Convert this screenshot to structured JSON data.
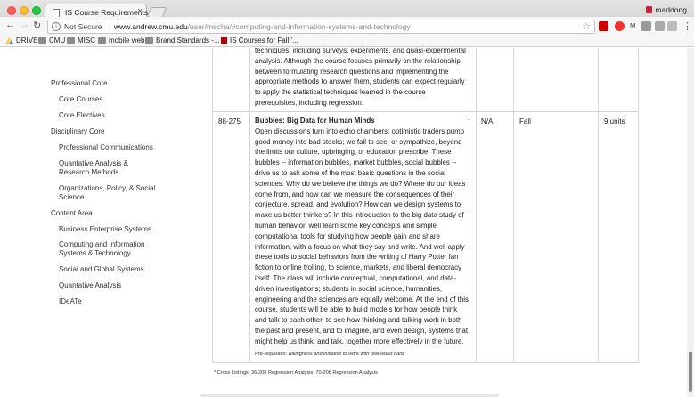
{
  "browser": {
    "tab_title": "IS Course Requirements",
    "tab_close": "×",
    "profile_name": "maddong",
    "not_secure": "Not Secure",
    "url_host": "www.andrew.cmu.edu",
    "url_path": "/user/mecha/#computing-and-information-systems-and-technology",
    "ext_m": "M",
    "bookmarks": [
      {
        "label": "DRIVE",
        "icon": "drive-icon"
      },
      {
        "label": "CMU",
        "icon": "folder-icon"
      },
      {
        "label": "MISC",
        "icon": "folder-icon"
      },
      {
        "label": "mobile web",
        "icon": "folder-icon"
      },
      {
        "label": "Brand Standards -...",
        "icon": "folder-icon"
      },
      {
        "label": "IS Courses for Fall '...",
        "icon": "cmu-icon"
      }
    ]
  },
  "sidebar": {
    "items": [
      {
        "label": "Professional Core"
      },
      {
        "label": "Core Courses"
      },
      {
        "label": "Core Electives"
      },
      {
        "label": "Disciplinary Core"
      },
      {
        "label": "Professional Communications"
      },
      {
        "label": "Quantative Analysis & Research Methods"
      },
      {
        "label": "Organizations, Policy, & Social Science"
      },
      {
        "label": "Content Area"
      },
      {
        "label": "Business Enterprise Systems"
      },
      {
        "label": "Computing and Information Systems & Technology"
      },
      {
        "label": "Social and Global Systems"
      },
      {
        "label": "Quantative Analysis"
      },
      {
        "label": "IDeATe"
      }
    ]
  },
  "table": {
    "prev_row_lines": [
      "techniques, including surveys, experiments, and quasi-experimental",
      "analysis. Although the course focuses primarily on the relationship",
      "between formulating research questions and implementing the",
      "appropriate methods to answer them, students can expect regularly",
      "to apply the statistical techniques learned in the course",
      "prerequisites, including regression."
    ],
    "row": {
      "number": "88-275",
      "title": "Bubbles: Big Data for Human Minds",
      "dash": "-",
      "prereq_col": "N/A",
      "semester": "Fall",
      "units": "9 units",
      "description_lines": [
        "Open discussions turn into echo chambers; optimistic traders pump",
        "good money into bad stocks; we fail to see, or sympathize, beyond",
        "the limits our culture, upbringing, or education prescribe. These",
        "bubbles -- information bubbles, market bubbles, social bubbles --",
        "drive us to ask some of the most basic questions in the social",
        "sciences: Why do we believe the things we do? Where do our ideas",
        "come from, and how can we measure the consequences of their",
        "conjecture, spread, and evolution? How can we design systems to",
        "make us better thinkers? In this introduction to the big data study of",
        "human behavior, well learn some key concepts and simple",
        "computational tools for studying how people gain and share",
        "information, with a focus on what they say and write. And well apply",
        "these tools to social behaviors from the writing of Harry Potter fan",
        "fiction to online trolling, to science, markets, and liberal democracy",
        "itself. The class will include conceptual, computational, and data-",
        "driven investigations; students in social science, humanities,",
        "engineering and the sciences are equally welcome. At the end of this",
        "course, students will be able to build models for how people think",
        "and talk to each other, to see how thinking and talking work in both",
        "the past and present, and to imagine, and even design, systems that",
        "might help us think, and talk, together more effectively in the future."
      ],
      "prerequisites": "Pre-requisites: willingness and initiative to work with real-world data."
    }
  },
  "footnote": "* Cross Listings: 36-208 Regression Analysis, 70-208 Regression Analysis"
}
